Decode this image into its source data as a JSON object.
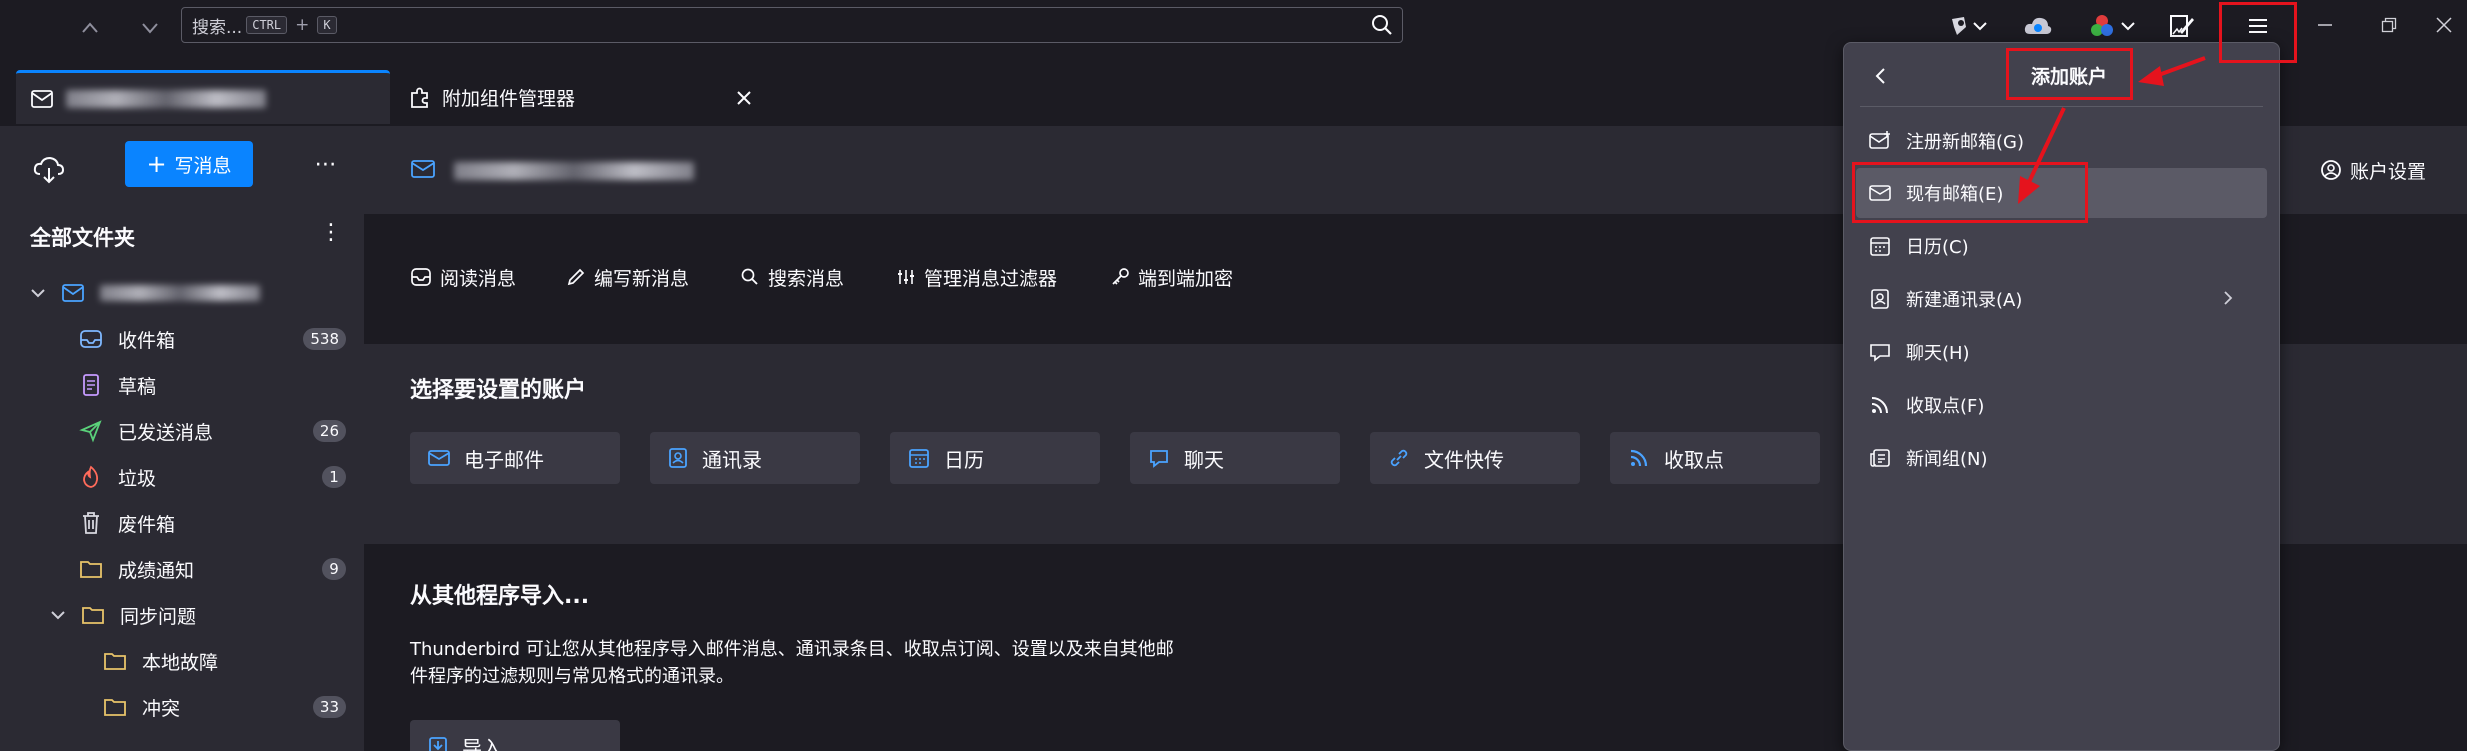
{
  "topbar": {
    "search_placeholder": "搜索...",
    "shortcut_key1": "CTRL",
    "shortcut_plus": "+",
    "shortcut_key2": "K"
  },
  "tabs": [
    {
      "label": "",
      "active": true,
      "blurred": true
    },
    {
      "label": "附加组件管理器",
      "active": false
    }
  ],
  "folder_pane": {
    "write_label": "写消息",
    "all_folders_label": "全部文件夹",
    "folders": [
      {
        "name": "收件箱",
        "icon": "inbox-icon",
        "count": "538"
      },
      {
        "name": "草稿",
        "icon": "drafts-icon",
        "count": ""
      },
      {
        "name": "已发送消息",
        "icon": "sent-icon",
        "count": "26"
      },
      {
        "name": "垃圾",
        "icon": "junk-icon",
        "count": "1"
      },
      {
        "name": "废件箱",
        "icon": "trash-icon",
        "count": ""
      },
      {
        "name": "成绩通知",
        "icon": "folder-icon",
        "count": "9"
      },
      {
        "name": "同步问题",
        "icon": "folder-icon",
        "count": ""
      },
      {
        "name": "本地故障",
        "icon": "folder-icon",
        "count": ""
      },
      {
        "name": "冲突",
        "icon": "folder-icon",
        "count": "33"
      }
    ]
  },
  "main": {
    "account_settings_label": "账户设置",
    "actions": [
      "阅读消息",
      "编写新消息",
      "搜索消息",
      "管理消息过滤器",
      "端到端加密"
    ],
    "setup_title": "选择要设置的账户",
    "setup_buttons": [
      "电子邮件",
      "通讯录",
      "日历",
      "聊天",
      "文件快传",
      "收取点"
    ],
    "import_title": "从其他程序导入...",
    "import_desc_line1": "Thunderbird 可让您从其他程序导入邮件消息、通讯录条目、收取点订阅、设置以及来自其他邮",
    "import_desc_line2": "件程序的过滤规则与常见格式的通讯录。",
    "import_button": "导入"
  },
  "app_menu": {
    "title": "添加账户",
    "items": [
      {
        "label": "注册新邮箱(G)",
        "icon": "new-mail-icon",
        "highlighted": false
      },
      {
        "label": "现有邮箱(E)",
        "icon": "mail-icon",
        "highlighted": true
      },
      {
        "label": "日历(C)",
        "icon": "calendar-icon",
        "highlighted": false
      },
      {
        "label": "新建通讯录(A)",
        "icon": "address-book-icon",
        "highlighted": false,
        "submenu": true
      },
      {
        "label": "聊天(H)",
        "icon": "chat-icon",
        "highlighted": false
      },
      {
        "label": "收取点(F)",
        "icon": "feed-icon",
        "highlighted": false
      },
      {
        "label": "新闻组(N)",
        "icon": "newsgroup-icon",
        "highlighted": false
      }
    ]
  },
  "colors": {
    "accent": "#0a84ff",
    "annotation": "#e5131d",
    "menu_bg": "#42414d"
  }
}
